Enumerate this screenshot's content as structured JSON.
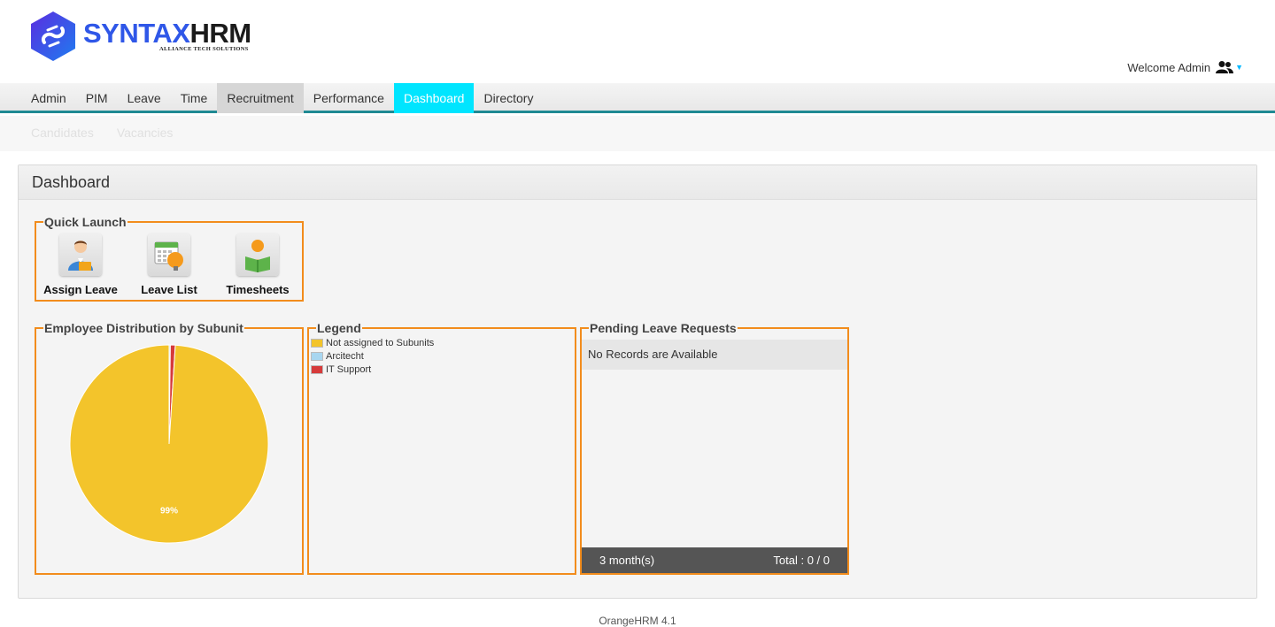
{
  "header": {
    "brand_part1": "SYNTAX",
    "brand_part2": "HRM",
    "tagline": "ALLIANCE TECH SOLUTIONS",
    "welcome": "Welcome Admin",
    "colors": {
      "brand_blue": "#2f57e8",
      "accent_cyan": "#00e5ff",
      "menu_border": "#1f8a93",
      "fieldset_orange": "#f28c1c"
    }
  },
  "menu": {
    "items": [
      "Admin",
      "PIM",
      "Leave",
      "Time",
      "Recruitment",
      "Performance",
      "Dashboard",
      "Directory"
    ],
    "hovered": "Recruitment",
    "selected": "Dashboard"
  },
  "submenu": {
    "items": [
      "Candidates",
      "Vacancies"
    ]
  },
  "dashboard": {
    "title": "Dashboard",
    "quick_launch": {
      "legend": "Quick Launch",
      "items": [
        {
          "label": "Assign Leave",
          "icon": "assign-leave-icon"
        },
        {
          "label": "Leave List",
          "icon": "leave-list-icon"
        },
        {
          "label": "Timesheets",
          "icon": "timesheets-icon"
        }
      ]
    },
    "employee_distribution": {
      "legend": "Employee Distribution by Subunit"
    },
    "legend_panel": {
      "legend": "Legend",
      "items": [
        {
          "label": "Not assigned to Subunits",
          "color": "#f3c42b"
        },
        {
          "label": "Arcitecht",
          "color": "#a8d6f0"
        },
        {
          "label": "IT Support",
          "color": "#d63a3a"
        }
      ]
    },
    "pending_leave": {
      "legend": "Pending Leave Requests",
      "empty_message": "No Records are Available",
      "period": "3 month(s)",
      "total": "Total : 0 / 0"
    }
  },
  "chart_data": {
    "type": "pie",
    "categories": [
      "Not assigned to Subunits",
      "Arcitecht",
      "IT Support"
    ],
    "values": [
      99,
      0.2,
      0.8
    ],
    "slice_labels": [
      "99%",
      "",
      ""
    ],
    "colors": [
      "#f3c42b",
      "#a8d6f0",
      "#d63a3a"
    ]
  },
  "footer": {
    "text": "OrangeHRM 4.1"
  }
}
